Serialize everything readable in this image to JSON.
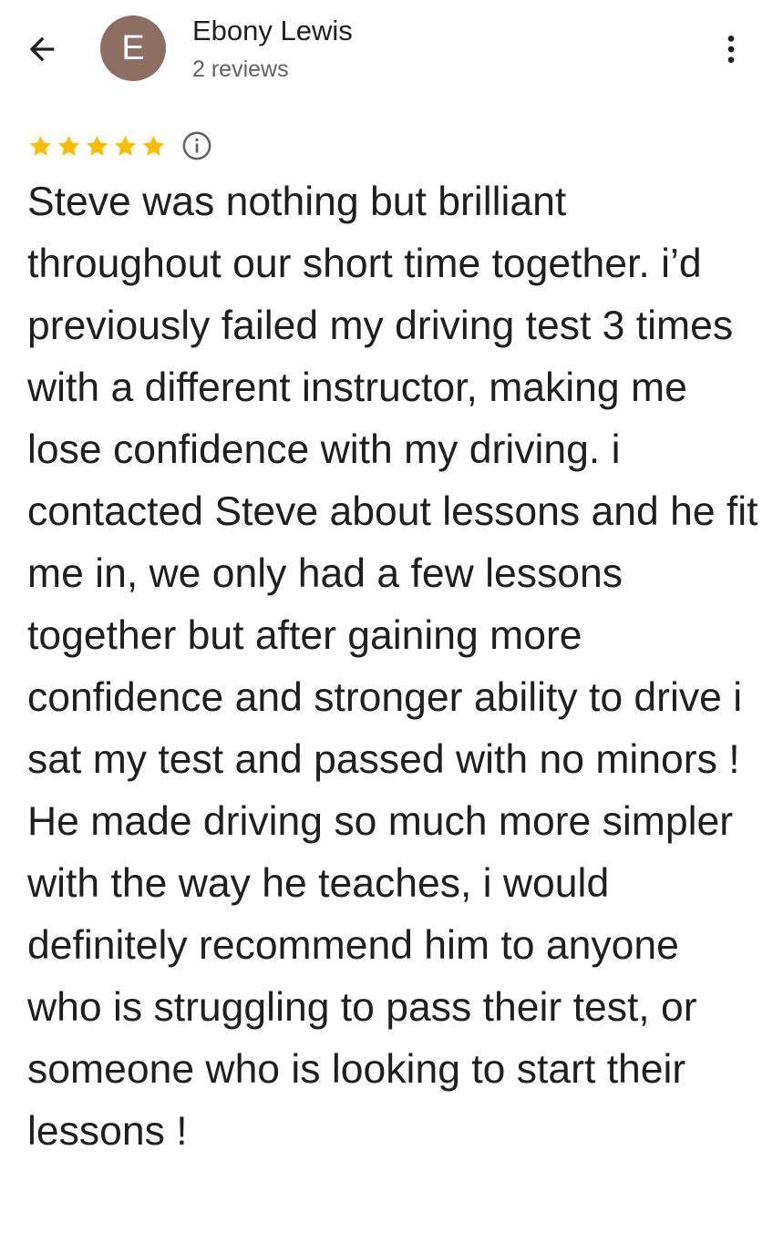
{
  "header": {
    "avatar_initial": "E",
    "name": "Ebony Lewis",
    "review_count": "2 reviews"
  },
  "review": {
    "rating": 5,
    "max_rating": 5,
    "text": "Steve was nothing but brilliant throughout our short time together. i’d previously failed my driving test 3 times with a different instructor, making me lose confidence with my driving. i contacted Steve about lessons and he fit me in, we only had a few lessons together but after gaining more confidence and stronger ability to drive i sat my test and passed with no minors ! He made driving so much more simpler with the way he teaches, i would definitely recommend him to anyone who is struggling to pass their test, or someone who is looking to start their lessons !"
  },
  "icons": {
    "back": "arrow-left-icon",
    "more": "more-vertical-icon",
    "star": "star-icon",
    "info": "info-icon"
  },
  "colors": {
    "avatar_bg": "#8d6e63",
    "star": "#fbbc04",
    "text": "#1f1f1f",
    "secondary_text": "#5f6368"
  }
}
